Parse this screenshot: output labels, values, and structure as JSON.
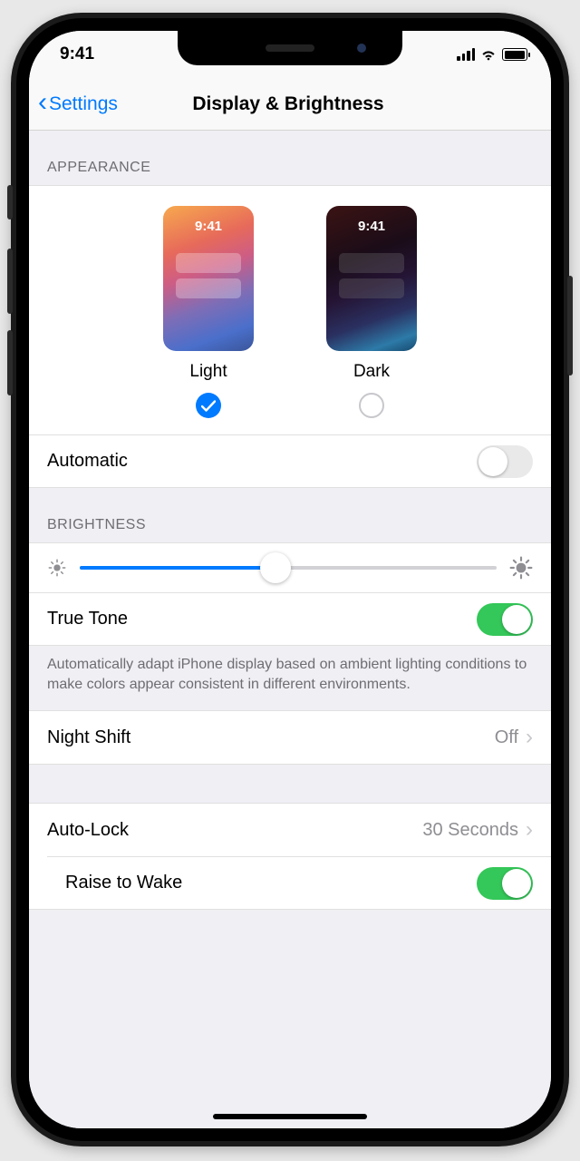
{
  "statusbar": {
    "time": "9:41"
  },
  "nav": {
    "back": "Settings",
    "title": "Display & Brightness"
  },
  "appearance": {
    "header": "Appearance",
    "light_label": "Light",
    "dark_label": "Dark",
    "thumb_time": "9:41",
    "selected": "light",
    "automatic_label": "Automatic",
    "automatic_on": false
  },
  "brightness": {
    "header": "Brightness",
    "level_percent": 47,
    "true_tone_label": "True Tone",
    "true_tone_on": true,
    "true_tone_note": "Automatically adapt iPhone display based on ambient lighting conditions to make colors appear consistent in different environments."
  },
  "night_shift": {
    "label": "Night Shift",
    "value": "Off"
  },
  "auto_lock": {
    "label": "Auto-Lock",
    "value": "30 Seconds"
  },
  "raise_to_wake": {
    "label": "Raise to Wake",
    "on": true
  }
}
